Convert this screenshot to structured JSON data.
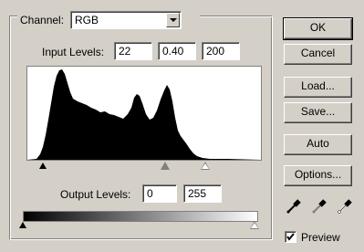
{
  "channel": {
    "label": "Channel:",
    "value": "RGB"
  },
  "input_levels": {
    "label": "Input Levels:",
    "black": "22",
    "gamma": "0.40",
    "white": "200"
  },
  "output_levels": {
    "label": "Output Levels:",
    "black": "0",
    "white": "255"
  },
  "buttons": {
    "ok": "OK",
    "cancel": "Cancel",
    "load": "Load...",
    "save": "Save...",
    "auto": "Auto",
    "options": "Options..."
  },
  "eyedroppers": [
    "black-point-eyedropper-icon",
    "gray-point-eyedropper-icon",
    "white-point-eyedropper-icon"
  ],
  "preview": {
    "label": "Preview",
    "checked": true
  },
  "input_slider_levels": {
    "black": 22,
    "gamma": 0.4,
    "white": 200
  },
  "output_slider_levels": {
    "black": 0,
    "white": 255
  }
}
